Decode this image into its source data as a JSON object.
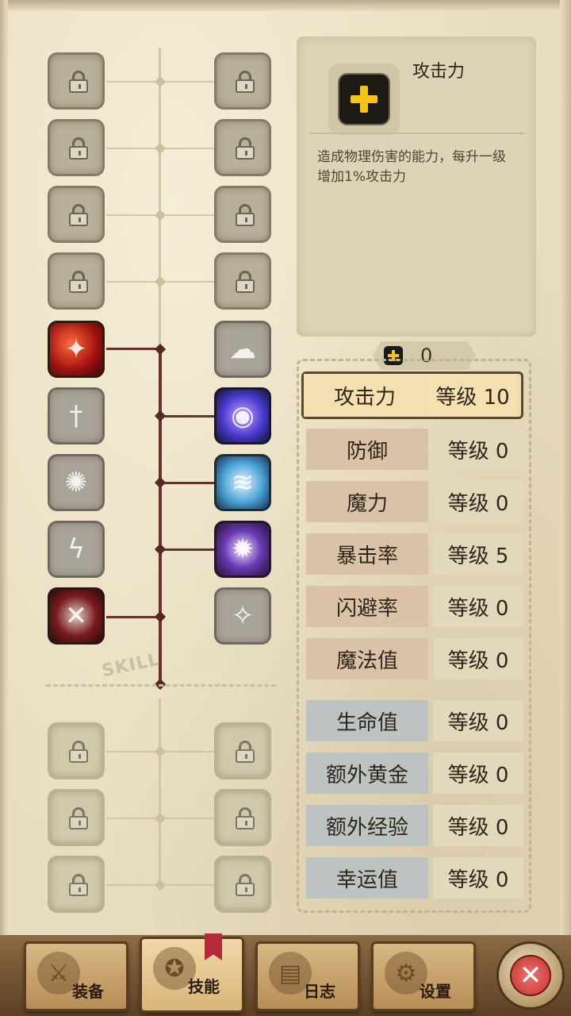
{
  "info": {
    "title": "攻击力",
    "description": "造成物理伤害的能力，每升一级增加1%攻击力"
  },
  "points": {
    "value": "0"
  },
  "stats": [
    {
      "name": "攻击力",
      "level": "等级 10"
    },
    {
      "name": "防御",
      "level": "等级 0"
    },
    {
      "name": "魔力",
      "level": "等级 0"
    },
    {
      "name": "暴击率",
      "level": "等级 5"
    },
    {
      "name": "闪避率",
      "level": "等级 0"
    },
    {
      "name": "魔法值",
      "level": "等级 0"
    },
    {
      "name": "生命值",
      "level": "等级 0"
    },
    {
      "name": "额外黄金",
      "level": "等级 0"
    },
    {
      "name": "额外经验",
      "level": "等级 0"
    },
    {
      "name": "幸运值",
      "level": "等级 0"
    }
  ],
  "tree": {
    "watermark": "SKILL"
  },
  "nav": {
    "equip": "装备",
    "skills": "技能",
    "log": "日志",
    "settings": "设置"
  },
  "colors": {
    "accent_yellow": "#f4c418",
    "tree_active": "#6b2f2f",
    "close_red": "#c6322e"
  }
}
